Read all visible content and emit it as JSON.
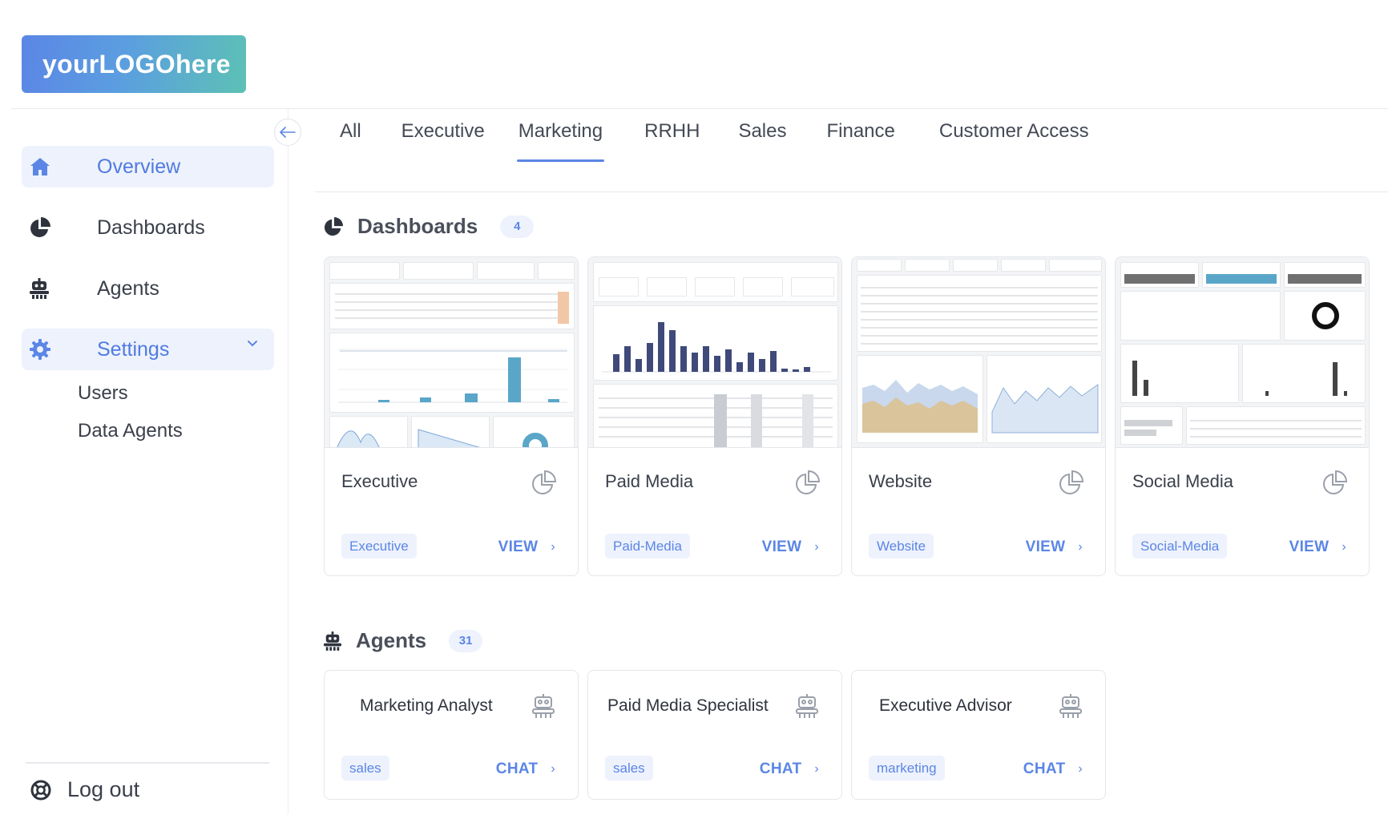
{
  "brand": {
    "logo_text": "yourLOGOhere"
  },
  "sidebar": {
    "collapse_icon": "arrow-left-icon",
    "items": [
      {
        "label": "Overview",
        "icon": "home-icon",
        "active": true
      },
      {
        "label": "Dashboards",
        "icon": "pie-chart-icon",
        "active": false
      },
      {
        "label": "Agents",
        "icon": "robot-icon",
        "active": false
      },
      {
        "label": "Settings",
        "icon": "gear-icon",
        "active": true,
        "expanded": true
      }
    ],
    "settings_subitems": [
      "Users",
      "Data Agents"
    ],
    "logout_label": "Log out"
  },
  "tabs": {
    "items": [
      "All",
      "Executive",
      "Marketing",
      "RRHH",
      "Sales",
      "Finance",
      "Customer Access"
    ],
    "active": "Marketing"
  },
  "dashboards_section": {
    "title": "Dashboards",
    "count": "4",
    "cards": [
      {
        "title": "Executive",
        "tag": "Executive",
        "action": "VIEW"
      },
      {
        "title": "Paid Media",
        "tag": "Paid-Media",
        "action": "VIEW"
      },
      {
        "title": "Website",
        "tag": "Website",
        "action": "VIEW"
      },
      {
        "title": "Social Media",
        "tag": "Social-Media",
        "action": "VIEW"
      }
    ]
  },
  "agents_section": {
    "title": "Agents",
    "count": "31",
    "cards": [
      {
        "title": "Marketing Analyst",
        "tag": "sales",
        "action": "CHAT"
      },
      {
        "title": "Paid Media Specialist",
        "tag": "sales",
        "action": "CHAT"
      },
      {
        "title": "Executive Advisor",
        "tag": "marketing",
        "action": "CHAT"
      }
    ]
  },
  "colors": {
    "accent": "#5b86e5",
    "accent_bg": "#eef2fd",
    "chart_navy": "#3f4a7a",
    "chart_teal": "#5aa6c9",
    "chart_tan": "#cdb48a"
  }
}
